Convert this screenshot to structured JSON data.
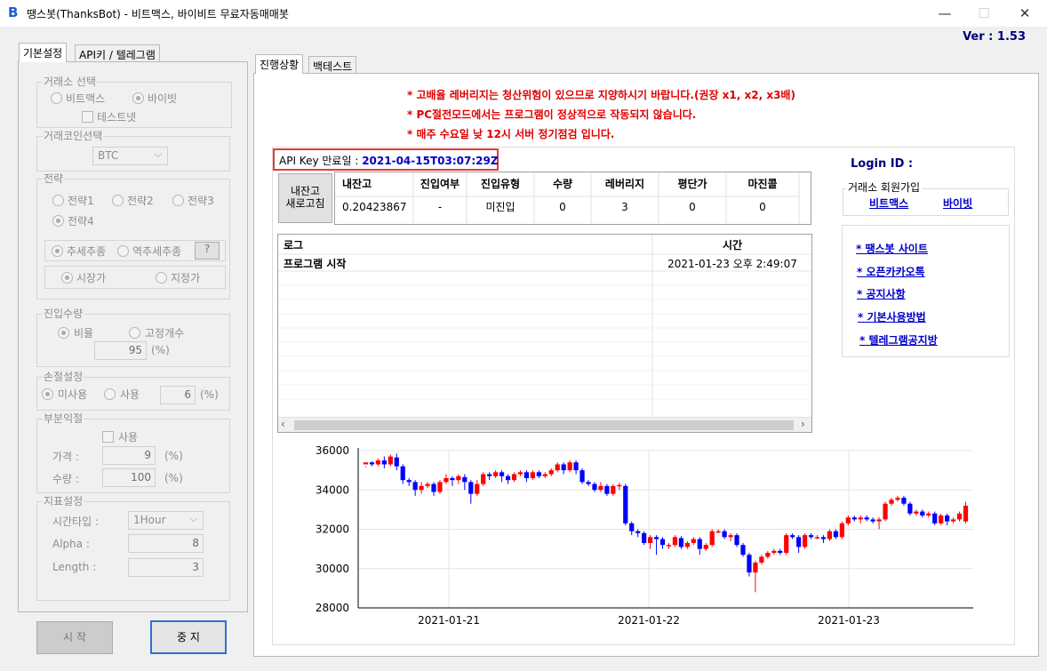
{
  "window": {
    "title": "땡스봇(ThanksBot) - 비트맥스, 바이비트 무료자동매매봇",
    "icon": "B",
    "min": "—",
    "max": "☐",
    "close": "✕",
    "version_label": "Ver :",
    "version": "1.53"
  },
  "left_tabs": [
    "기본설정",
    "API키 / 텔레그램"
  ],
  "exchange": {
    "title": "거래소 선택",
    "options": [
      "비트맥스",
      "바이빗"
    ],
    "selected": "바이빗",
    "testnet": "테스트넷"
  },
  "coin": {
    "title": "거래코인선택",
    "value": "BTC"
  },
  "strategy": {
    "title": "전략",
    "options": [
      "전략1",
      "전략2",
      "전략3",
      "전략4"
    ],
    "selected": "전략4",
    "trend": [
      "추세추종",
      "역추세추종"
    ],
    "help": "?",
    "order": [
      "시장가",
      "지정가"
    ]
  },
  "entry": {
    "title": "진입수량",
    "options": [
      "비율",
      "고정개수"
    ],
    "value": "95",
    "unit": "(%)"
  },
  "stoploss": {
    "title": "손절설정",
    "options": [
      "미사용",
      "사용"
    ],
    "value": "6",
    "unit": "(%)"
  },
  "partial": {
    "title": "부분익절",
    "use": "사용",
    "price_label": "가격 :",
    "price": "9",
    "qty_label": "수량 :",
    "qty": "100",
    "unit": "(%)"
  },
  "indicator": {
    "title": "지표설정",
    "time_label": "시간타입 :",
    "time_value": "1Hour",
    "alpha_label": "Alpha :",
    "alpha": "8",
    "length_label": "Length :",
    "length": "3"
  },
  "buttons": {
    "start": "시 작",
    "stop": "중 지",
    "refresh": "내잔고\n새로고침"
  },
  "right_tabs": [
    "진행상황",
    "백테스트"
  ],
  "notices": [
    "* 고배율 레버리지는 청산위험이 있으므로 지양하시기 바랍니다.(권장 x1, x2, x3배)",
    "* PC절전모드에서는 프로그램이 정상적으로 작동되지 않습니다.",
    "* 매주 수요일 낮 12시 서버 정기점검 입니다."
  ],
  "api": {
    "label": "API Key 만료일 :",
    "date": "2021-04-15T03:07:29Z"
  },
  "balance": {
    "headers": [
      "내잔고",
      "진입여부",
      "진입유형",
      "수량",
      "레버리지",
      "평단가",
      "마진콜"
    ],
    "values": [
      "0.20423867",
      "-",
      "미진입",
      "0",
      "3",
      "0",
      "0"
    ]
  },
  "login": {
    "label": "Login ID :",
    "signup_title": "거래소 회원가입",
    "links": [
      "비트맥스",
      "바이빗"
    ]
  },
  "log": {
    "headers": [
      "로그",
      "시간"
    ],
    "rows": [
      {
        "text": "프로그램 시작",
        "time": "2021-01-23 오후 2:49:07"
      }
    ],
    "scroll_left": "‹",
    "scroll_right": "›"
  },
  "site_links": [
    "* 땡스봇 사이트",
    "* 오픈카카오톡",
    "* 공지사항",
    "* 기본사용방법",
    "* 텔레그램공지방"
  ],
  "colors": {
    "up": "#ff0000",
    "down": "#0000ff",
    "notice": "#e00000",
    "link": "#0000c8",
    "api_box": "#e03c3c"
  },
  "chart_data": {
    "type": "candlestick",
    "x_ticks": [
      "2021-01-21",
      "2021-01-22",
      "2021-01-23"
    ],
    "y_ticks": [
      36000,
      34000,
      32000,
      30000,
      28000
    ],
    "ylim": [
      28000,
      36000
    ],
    "grid": true,
    "candles": [
      [
        35300,
        35400,
        35200,
        35150
      ],
      [
        35400,
        35300,
        35200,
        35450
      ],
      [
        35300,
        35500,
        35200,
        35600
      ],
      [
        35500,
        35300,
        35100,
        35700
      ],
      [
        35300,
        35700,
        35200,
        35800
      ],
      [
        35650,
        35200,
        35000,
        35850
      ],
      [
        35200,
        34500,
        34300,
        35300
      ],
      [
        34500,
        34400,
        34200,
        34600
      ],
      [
        34400,
        34000,
        33700,
        34500
      ],
      [
        34000,
        34200,
        33800,
        34400
      ],
      [
        34200,
        34300,
        34100,
        34400
      ],
      [
        34300,
        33900,
        33700,
        34400
      ],
      [
        33900,
        34400,
        33800,
        34500
      ],
      [
        34400,
        34600,
        34300,
        34800
      ],
      [
        34600,
        34500,
        34200,
        34700
      ],
      [
        34500,
        34700,
        34300,
        34800
      ],
      [
        34650,
        34400,
        34000,
        34800
      ],
      [
        34400,
        33800,
        33300,
        34500
      ],
      [
        33800,
        34300,
        33700,
        34500
      ],
      [
        34300,
        34800,
        34200,
        34900
      ],
      [
        34800,
        34700,
        34500,
        34900
      ],
      [
        34700,
        34900,
        34600,
        35000
      ],
      [
        34900,
        34700,
        34400,
        35000
      ],
      [
        34700,
        34500,
        34300,
        34800
      ],
      [
        34500,
        34800,
        34400,
        34900
      ],
      [
        34800,
        34900,
        34700,
        35000
      ],
      [
        34900,
        34600,
        34400,
        35000
      ],
      [
        34600,
        34900,
        34500,
        35000
      ],
      [
        34900,
        34700,
        34600,
        35000
      ],
      [
        34700,
        34800,
        34600,
        34900
      ],
      [
        34800,
        35000,
        34700,
        35100
      ],
      [
        35000,
        35300,
        34900,
        35400
      ],
      [
        35300,
        35000,
        34800,
        35400
      ],
      [
        35000,
        35400,
        34900,
        35500
      ],
      [
        35400,
        35000,
        34800,
        35500
      ],
      [
        35000,
        34400,
        34300,
        35100
      ],
      [
        34400,
        34300,
        34200,
        34500
      ],
      [
        34300,
        34000,
        33900,
        34400
      ],
      [
        34000,
        34200,
        33900,
        34400
      ],
      [
        34200,
        33800,
        33700,
        34300
      ],
      [
        33800,
        34200,
        33700,
        34300
      ],
      [
        34250,
        34250,
        34000,
        34350
      ],
      [
        34200,
        32300,
        32200,
        34300
      ],
      [
        32300,
        31900,
        31700,
        32400
      ],
      [
        31900,
        31800,
        31600,
        32000
      ],
      [
        31800,
        31300,
        31200,
        31900
      ],
      [
        31300,
        31600,
        31000,
        31700
      ],
      [
        31600,
        31500,
        30700,
        31700
      ],
      [
        31500,
        31200,
        31000,
        31600
      ],
      [
        31200,
        31200,
        31000,
        31300
      ],
      [
        31200,
        31600,
        31100,
        31700
      ],
      [
        31550,
        31100,
        31000,
        31650
      ],
      [
        31100,
        31300,
        31000,
        31400
      ],
      [
        31300,
        31500,
        31200,
        31600
      ],
      [
        31500,
        31000,
        30700,
        31600
      ],
      [
        31000,
        31200,
        30900,
        31300
      ],
      [
        31200,
        31900,
        31100,
        32000
      ],
      [
        31900,
        31900,
        31800,
        32000
      ],
      [
        31900,
        31600,
        31500,
        32000
      ],
      [
        31600,
        31700,
        31400,
        31800
      ],
      [
        31700,
        31200,
        31100,
        31800
      ],
      [
        31200,
        30700,
        30600,
        31300
      ],
      [
        30700,
        29800,
        29600,
        30800
      ],
      [
        29800,
        30300,
        28800,
        30400
      ],
      [
        30300,
        30600,
        30200,
        30700
      ],
      [
        30600,
        30800,
        30500,
        30900
      ],
      [
        30800,
        30900,
        30700,
        31000
      ],
      [
        30900,
        30800,
        30700,
        31000
      ],
      [
        30800,
        31700,
        30700,
        31800
      ],
      [
        31700,
        31600,
        31500,
        31800
      ],
      [
        31600,
        31100,
        30800,
        31700
      ],
      [
        31100,
        31700,
        31000,
        31800
      ],
      [
        31700,
        31600,
        31500,
        31800
      ],
      [
        31600,
        31600,
        31500,
        31700
      ],
      [
        31600,
        31500,
        31300,
        31700
      ],
      [
        31500,
        31900,
        31400,
        32000
      ],
      [
        31900,
        31600,
        31500,
        32000
      ],
      [
        31600,
        32300,
        31500,
        32400
      ],
      [
        32300,
        32600,
        32200,
        32700
      ],
      [
        32600,
        32500,
        32400,
        32700
      ],
      [
        32500,
        32600,
        32300,
        32700
      ],
      [
        32600,
        32500,
        32400,
        32700
      ],
      [
        32500,
        32400,
        32300,
        32600
      ],
      [
        32400,
        32500,
        32000,
        32600
      ],
      [
        32500,
        33300,
        32400,
        33400
      ],
      [
        33300,
        33500,
        33200,
        33600
      ],
      [
        33500,
        33600,
        33400,
        33700
      ],
      [
        33600,
        33300,
        33200,
        33700
      ],
      [
        33300,
        32800,
        32700,
        33400
      ],
      [
        32800,
        32900,
        32700,
        33000
      ],
      [
        32900,
        32700,
        32600,
        33000
      ],
      [
        32700,
        32800,
        32600,
        32900
      ],
      [
        32800,
        32300,
        32200,
        32900
      ],
      [
        32300,
        32700,
        32200,
        32800
      ],
      [
        32700,
        32400,
        32200,
        32800
      ],
      [
        32400,
        32500,
        32300,
        32600
      ],
      [
        32500,
        32800,
        32400,
        32900
      ],
      [
        32400,
        33200,
        32300,
        33400
      ]
    ]
  }
}
